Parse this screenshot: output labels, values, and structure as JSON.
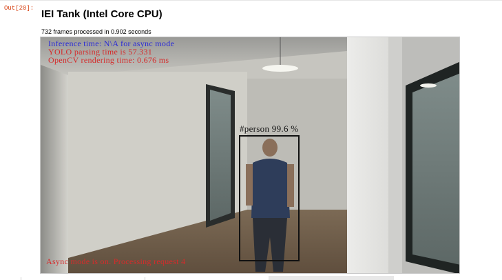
{
  "cell": {
    "prompt": "Out[20]:",
    "title": "IEI Tank (Intel Core CPU)",
    "subtitle": "732 frames processed in 0.902 seconds"
  },
  "video_frame": {
    "overlay": {
      "inference_time": "Inference time: N\\A for async mode",
      "yolo_parsing": "YOLO parsing time is 57.331",
      "opencv_rendering": "OpenCV rendering time: 0.676 ms",
      "async_status": "Async mode is on. Processing request 4"
    },
    "detection": {
      "label": "#person 99.6 %"
    },
    "colors": {
      "overlay_blue": "#2b2bd6",
      "overlay_red": "#d62b2b",
      "bbox": "#111111"
    }
  }
}
